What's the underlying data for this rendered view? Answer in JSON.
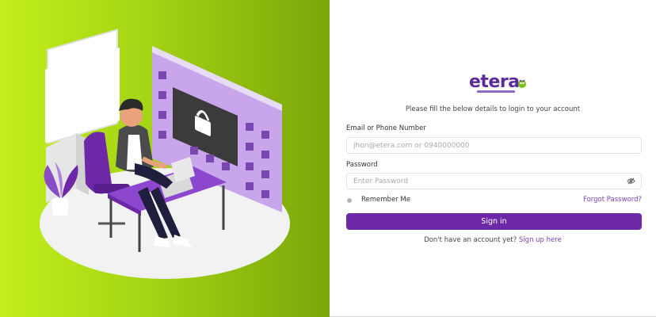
{
  "brand": {
    "logo_text": "etera",
    "logo_icon": "mascot-icon",
    "colors": {
      "primary": "#6d28a8",
      "link": "#7b3fb4",
      "left_gradient_start": "#c3ef1c",
      "left_gradient_end": "#7ba50a"
    }
  },
  "illustration": {
    "icon": "secure-login-illustration"
  },
  "login": {
    "subtitle": "Please fill the below details to login to your account",
    "email_label": "Email or Phone Number",
    "email_placeholder": "jhon@etera.com or 0940000000",
    "email_value": "",
    "password_label": "Password",
    "password_placeholder": "Enter Password",
    "password_value": "",
    "password_toggle_icon": "eye-slash-icon",
    "remember_label": "Remember Me",
    "remember_checked": false,
    "forgot_label": "Forgot Password?",
    "signin_label": "Sign in",
    "signup_prompt": "Don't have an account yet?",
    "signup_link": "Sign up here"
  }
}
